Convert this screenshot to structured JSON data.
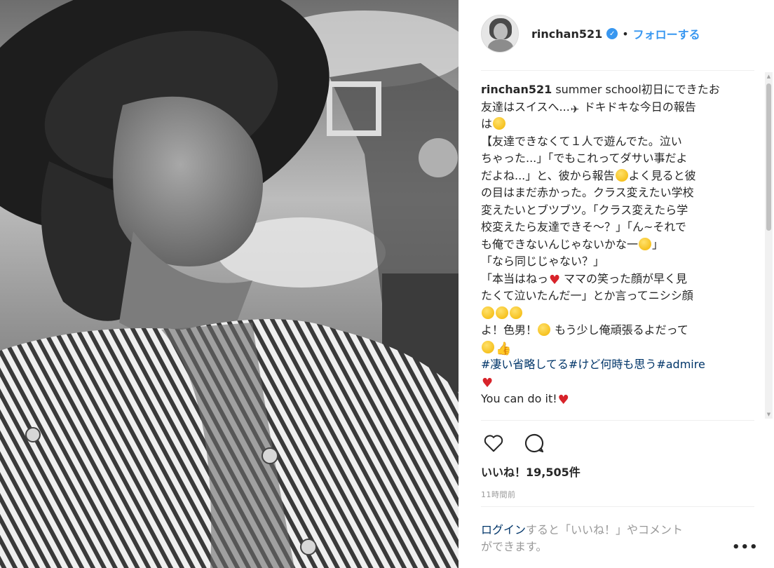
{
  "photo": {
    "alt_icon": "photo-portrait",
    "colors": {
      "sky": "#c9c9c9",
      "hat": "#1a1a1a"
    }
  },
  "header": {
    "username": "rinchan521",
    "verified_icon": "verified-badge-icon",
    "separator": "•",
    "follow_label": "フォローする"
  },
  "caption": {
    "username": "rinchan521",
    "lines": [
      "summer school初日にできたお",
      "友達はスイスへ...",
      "ドキドキな今日の報告",
      "は",
      "【友達できなくて１人で遊んでた。泣い",
      "ちゃった...」「でもこれってダサい事だよ",
      "だよね...」と、彼から報告",
      "よく見ると彼",
      "の目はまだ赤かった。クラス変えたい学校",
      "変えたいとブツブツ。「クラス変えたら学",
      "校変えたら友達できそ～？」「ん~それで",
      "も俺できないんじゃないかな一",
      "」",
      "「なら同じじゃない？」",
      "「本当はねっ",
      "ママの笑った顔が早く見",
      "たくて泣いたんだ一」とか言ってニシシ顔",
      "よ！色男！",
      "もう少し俺頑張るよだって",
      "#凄い省略してる#けど何時も思う#admire",
      "You can do it!"
    ]
  },
  "actions": {
    "like_icon": "heart-icon",
    "comment_icon": "comment-bubble-icon"
  },
  "likes": {
    "label": "いいね！",
    "count": "19,505件"
  },
  "timestamp": "11時間前",
  "login_prompt": {
    "link": "ログイン",
    "text": "すると「いいね！」やコメント",
    "text2": "ができます。"
  },
  "more_label": "•••",
  "colors": {
    "link": "#3897f0",
    "hashtag": "#003569",
    "muted": "#999999",
    "text": "#262626"
  }
}
